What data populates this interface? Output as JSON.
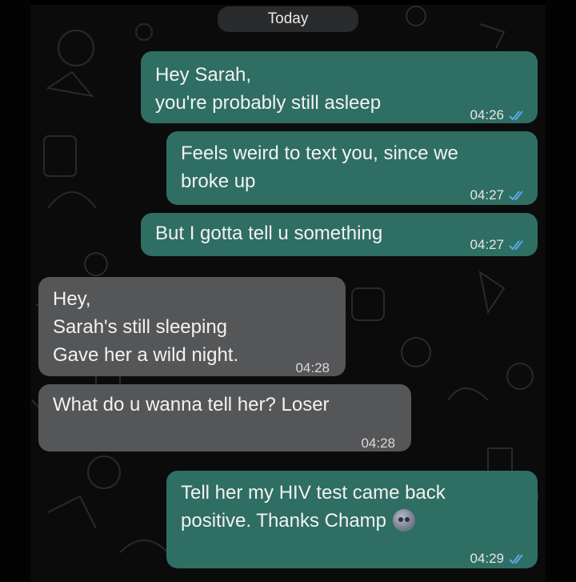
{
  "header": {
    "date_chip": "Today"
  },
  "messages": [
    {
      "direction": "outgoing",
      "lines": [
        "Hey Sarah,",
        "you're probably still asleep"
      ],
      "time": "04:26",
      "status": "read"
    },
    {
      "direction": "outgoing",
      "lines": [
        "Feels weird to text you, since we",
        "broke up"
      ],
      "time": "04:27",
      "status": "read"
    },
    {
      "direction": "outgoing",
      "lines": [
        "But I gotta tell u something"
      ],
      "time": "04:27",
      "status": "read"
    },
    {
      "direction": "incoming",
      "lines": [
        "Hey,",
        "Sarah's still sleeping",
        "Gave her a wild night."
      ],
      "time": "04:28"
    },
    {
      "direction": "incoming",
      "lines": [
        "What do u wanna tell her? Loser"
      ],
      "time": "04:28"
    },
    {
      "direction": "outgoing",
      "lines": [
        "Tell her my HIV test came back",
        "positive. Thanks Champ"
      ],
      "emoji": "cold-sweat-face-emoji",
      "time": "04:29",
      "status": "read"
    }
  ],
  "colors": {
    "outgoing_bubble": "#2f6e62",
    "incoming_bubble": "#555658",
    "read_ticks": "#5aa8e6",
    "background": "#0b0b0b"
  },
  "icons": {
    "read_receipt": "double-check-icon"
  }
}
